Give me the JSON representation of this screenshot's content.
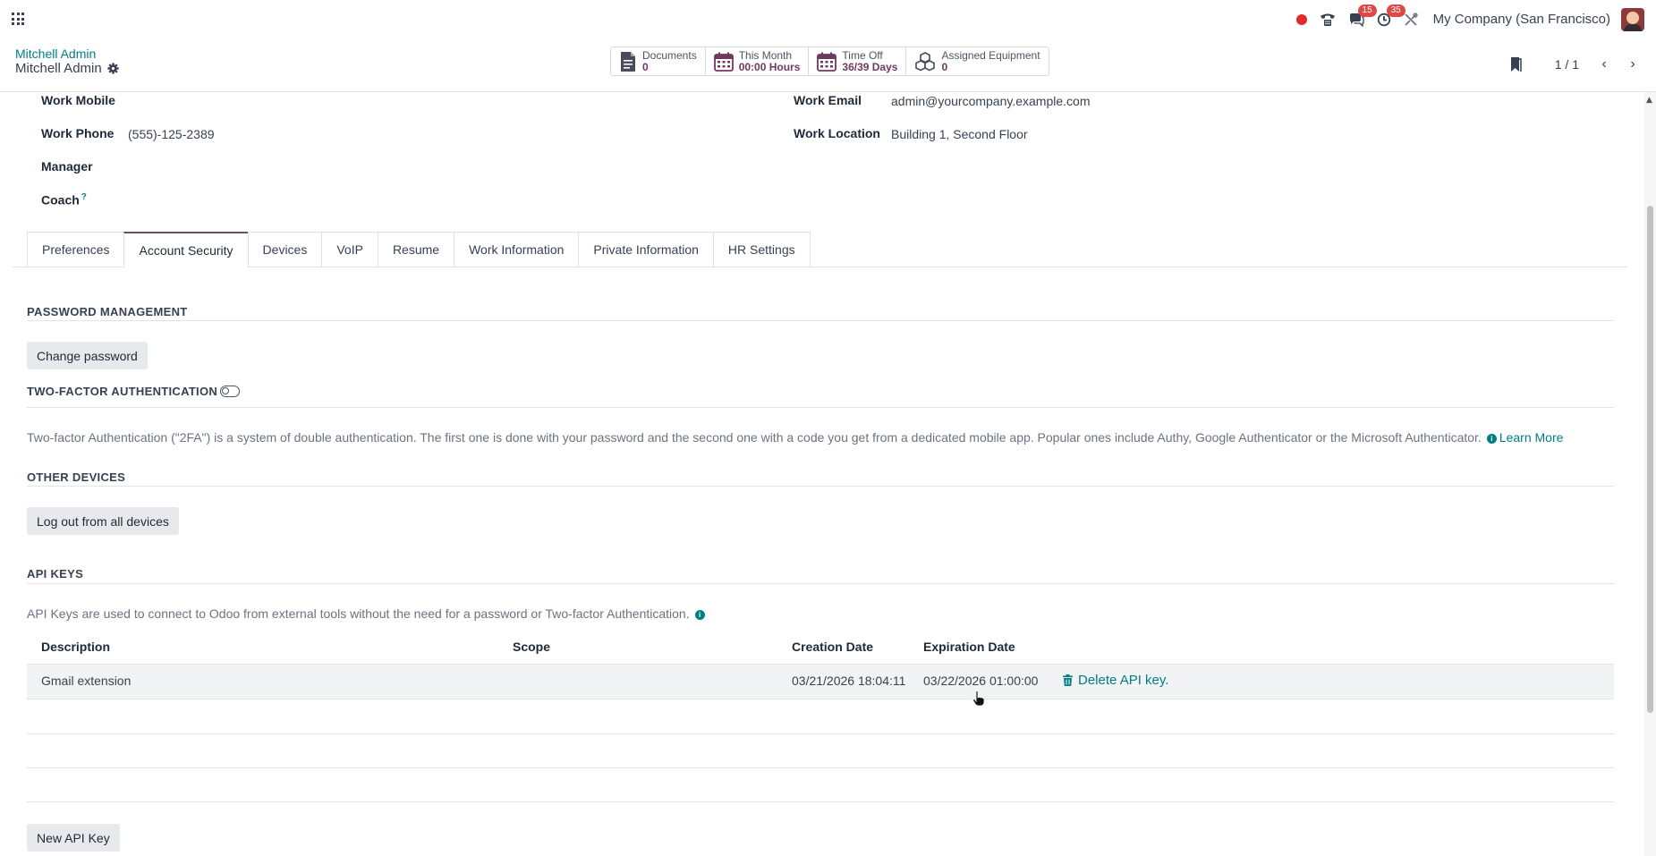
{
  "navbar": {
    "company": "My Company (San Francisco)",
    "messages_count": "15",
    "activities_count": "35"
  },
  "breadcrumb": {
    "parent": "Mitchell Admin",
    "current": "Mitchell Admin"
  },
  "stats": [
    {
      "label": "Documents",
      "value": "0",
      "icon": "document-icon"
    },
    {
      "label": "This Month",
      "value": "00:00 Hours",
      "icon": "calendar-icon"
    },
    {
      "label": "Time Off",
      "value": "36/39 Days",
      "icon": "calendar-icon"
    },
    {
      "label": "Assigned Equipment",
      "value": "0",
      "icon": "cubes-icon"
    }
  ],
  "pager": {
    "value": "1 / 1"
  },
  "fields": {
    "work_mobile_label": "Work Mobile",
    "work_phone_label": "Work Phone",
    "work_phone_value": "(555)-125-2389",
    "manager_label": "Manager",
    "coach_label": "Coach",
    "coach_help": "?",
    "work_email_label": "Work Email",
    "work_email_value": "admin@yourcompany.example.com",
    "work_location_label": "Work Location",
    "work_location_value": "Building 1, Second Floor"
  },
  "tabs": [
    {
      "label": "Preferences"
    },
    {
      "label": "Account Security",
      "active": true
    },
    {
      "label": "Devices"
    },
    {
      "label": "VoIP"
    },
    {
      "label": "Resume"
    },
    {
      "label": "Work Information"
    },
    {
      "label": "Private Information"
    },
    {
      "label": "HR Settings"
    }
  ],
  "security": {
    "password_title": "PASSWORD MANAGEMENT",
    "change_password": "Change password",
    "twofa_title": "TWO-FACTOR AUTHENTICATION",
    "twofa_desc": "Two-factor Authentication (\"2FA\") is a system of double authentication. The first one is done with your password and the second one with a code you get from a dedicated mobile app. Popular ones include Authy, Google Authenticator or the Microsoft Authenticator.",
    "learn_more": "Learn More",
    "devices_title": "OTHER DEVICES",
    "logout_all": "Log out from all devices",
    "api_title": "API KEYS",
    "api_desc": "API Keys are used to connect to Odoo from external tools without the need for a password or Two-factor Authentication.",
    "new_api_key": "New API Key"
  },
  "api_table": {
    "headers": {
      "description": "Description",
      "scope": "Scope",
      "creation": "Creation Date",
      "expiration": "Expiration Date"
    },
    "rows": [
      {
        "description": "Gmail extension",
        "scope": "",
        "creation": "03/21/2026 18:04:11",
        "expiration": "03/22/2026 01:00:00",
        "action": "Delete API key."
      }
    ]
  }
}
